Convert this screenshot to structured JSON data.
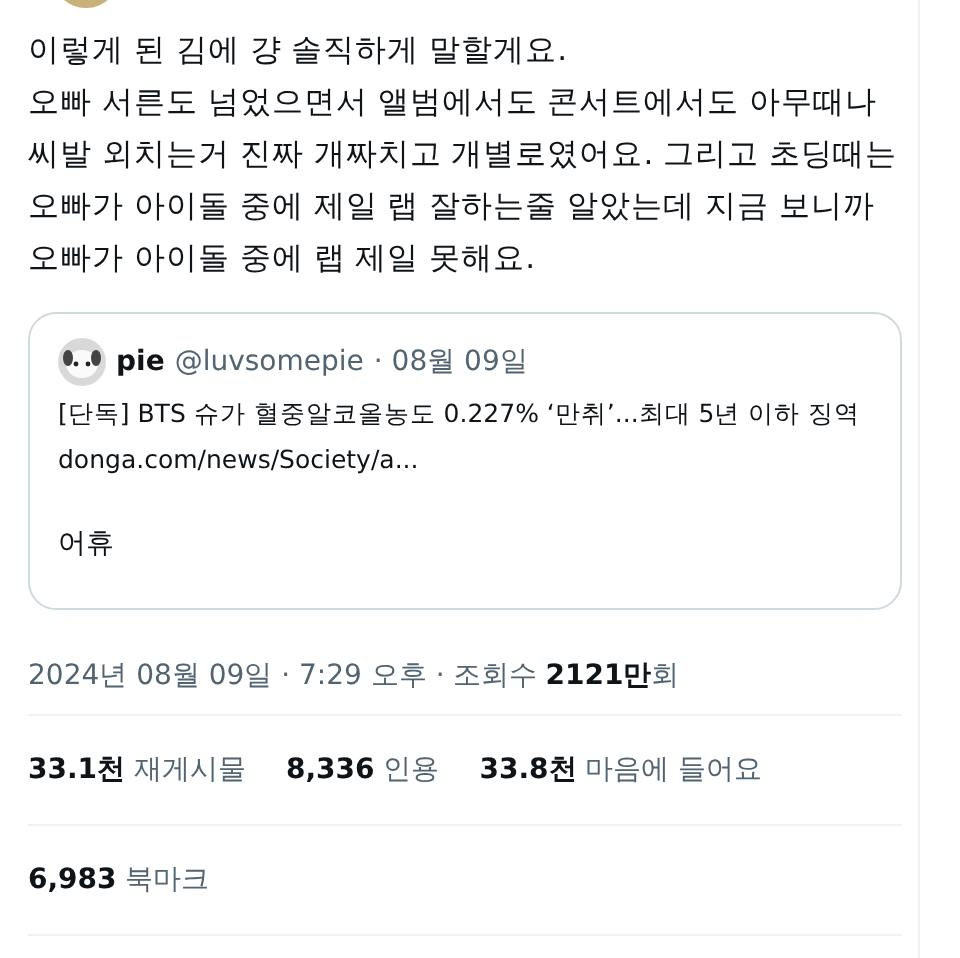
{
  "tweet": {
    "text": "이렇게 된 김에 걍 솔직하게 말할게요.\n오빠 서른도 넘었으면서 앨범에서도 콘서트에서도 아무때나\n씨발 외치는거 진짜 개짜치고 개별로였어요. 그리고 초딩때는\n오빠가 아이돌 중에 제일 랩 잘하는줄 알았는데 지금 보니까\n오빠가 아이돌 중에 랩 제일 못해요.",
    "quote": {
      "name": "pie",
      "handle": "@luvsomepie",
      "date": "· 08월 09일",
      "text": "[단독] BTS 슈가 혈중알코올농도 0.227% ‘만취’...최대 5년 이하 징역",
      "link": "donga.com/news/Society/a...",
      "comment": "어휴"
    },
    "meta": {
      "datetime": "2024년 08월 09일 · 7:29 오후 · 조회수",
      "views": "2121만",
      "views_unit": "회"
    },
    "stats": [
      {
        "count": "33.1천",
        "label": "재게시물"
      },
      {
        "count": "8,336",
        "label": "인용"
      },
      {
        "count": "33.8천",
        "label": "마음에 들어요"
      }
    ],
    "bookmarks": {
      "count": "6,983",
      "label": "북마크"
    }
  }
}
